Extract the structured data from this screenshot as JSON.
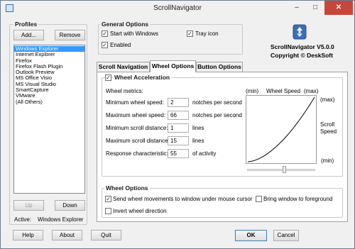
{
  "window": {
    "title": "ScrollNavigator",
    "minimize": "–",
    "maximize": "□",
    "close": "✕"
  },
  "profiles": {
    "title": "Profiles",
    "add_label": "Add...",
    "remove_label": "Remove",
    "items": [
      "Windows Explorer",
      "Internet Explorer",
      "Firefox",
      "Firefox Flash Plugin",
      "Outlook Preview",
      "MS Office Visio",
      "MS Visual Studio",
      "SmartCapture",
      "VMware",
      "(All Others)"
    ],
    "selected": "Windows Explorer",
    "up_label": "Up",
    "down_label": "Down",
    "active_label": "Active:",
    "active_value": "Windows Explorer"
  },
  "general": {
    "title": "General Options",
    "start_with_windows": "Start with Windows",
    "tray_icon": "Tray icon",
    "enabled": "Enabled"
  },
  "about": {
    "version": "ScrollNavigator V5.0.0",
    "copyright": "Copyright © DeskSoft",
    "icon": "app-logo-icon"
  },
  "tabs": [
    "Scroll Navigation",
    "Wheel Options",
    "Button Options"
  ],
  "active_tab": "Wheel Options",
  "wheel_acceleration": {
    "title": "Wheel Acceleration",
    "metrics_label": "Wheel metrics:",
    "rows": [
      {
        "label": "Minimum wheel speed:",
        "value": "2",
        "unit": "notches per second"
      },
      {
        "label": "Maximum wheel speed:",
        "value": "66",
        "unit": "notches per second"
      },
      {
        "label": "Minimum scroll distance:",
        "value": "1",
        "unit": "lines"
      },
      {
        "label": "Maximum scroll distance:",
        "value": "15",
        "unit": "lines"
      },
      {
        "label": "Response characteristic:",
        "value": "55",
        "unit": "of activity"
      }
    ]
  },
  "chart": {
    "min_label": "(min)",
    "title": "Wheel Speed",
    "max_label": "(max)",
    "y_max": "(max)",
    "y_title": "Scroll Speed",
    "y_min": "(min)",
    "slider_value": 0.55
  },
  "wheel_options": {
    "title": "Wheel Options",
    "send_wheel": "Send wheel movements to window under mouse cursor",
    "bring_window": "Bring window to foreground",
    "invert": "Invert wheel direction"
  },
  "footer": {
    "help": "Help",
    "about": "About",
    "quit": "Quit",
    "ok": "OK",
    "cancel": "Cancel"
  }
}
